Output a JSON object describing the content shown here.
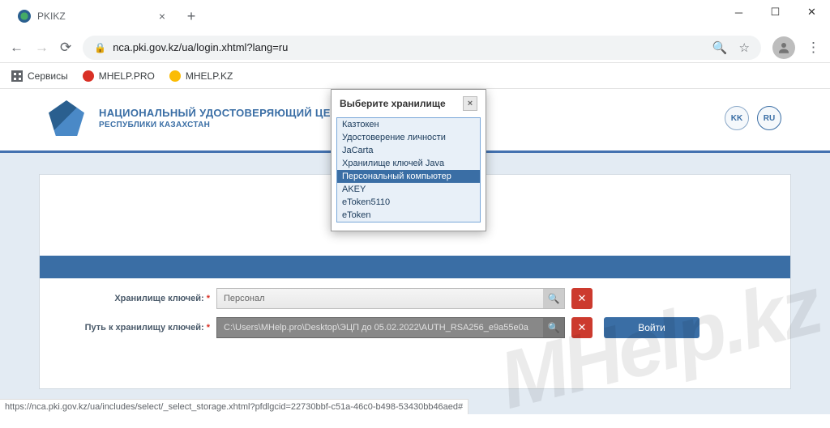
{
  "browser": {
    "tab_title": "PKIKZ",
    "url": "nca.pki.gov.kz/ua/login.xhtml?lang=ru",
    "bookmarks": {
      "apps": "Сервисы",
      "b1": "MHELP.PRO",
      "b2": "MHELP.KZ"
    },
    "status": "https://nca.pki.gov.kz/ua/includes/select/_select_storage.xhtml?pfdlgcid=22730bbf-c51a-46c0-b498-53430bb46aed#"
  },
  "header": {
    "title": "НАЦИОНАЛЬНЫЙ УДОСТОВЕРЯЮЩИЙ ЦЕНТР",
    "subtitle": "РЕСПУБЛИКИ КАЗАХСТАН",
    "lang_kk": "KK",
    "lang_ru": "RU"
  },
  "form": {
    "label_store": "Хранилище ключей:",
    "store_value": "Персонал",
    "label_path": "Путь к хранилищу ключей:",
    "path_value": "C:\\Users\\MHelp.pro\\Desktop\\ЭЦП до 05.02.2022\\AUTH_RSA256_e9a55e0a",
    "login": "Войти"
  },
  "dialog": {
    "title": "Выберите хранилище",
    "items": [
      "Казтокен",
      "Удостоверение личности",
      "JaCarta",
      "Хранилище ключей Java",
      "Персональный компьютер",
      "AKEY",
      "eToken5110",
      "eToken"
    ],
    "selected": 4
  },
  "watermark": "MHelp.kz"
}
